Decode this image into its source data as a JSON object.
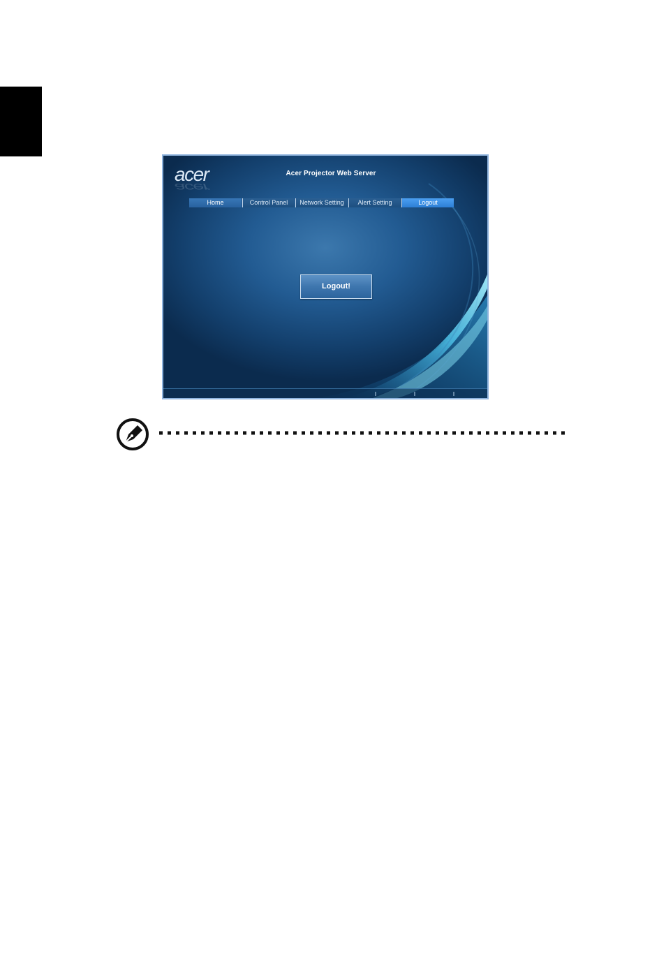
{
  "app": {
    "logo_text": "acer",
    "title": "Acer Projector Web Server"
  },
  "nav": {
    "items": [
      {
        "label": "Home"
      },
      {
        "label": "Control Panel"
      },
      {
        "label": "Network Setting"
      },
      {
        "label": "Alert Setting"
      },
      {
        "label": "Logout"
      }
    ],
    "active": "Logout"
  },
  "main": {
    "logout_button_label": "Logout!"
  },
  "colors": {
    "page_background": "#ffffff",
    "side_tab": "#000000",
    "frame_border": "#8fb4de",
    "app_background": "#225b92",
    "nav_active": "#2d7fd6",
    "accent_swoosh": "#5fd0ee"
  },
  "icons": {
    "note": "note-pen-icon",
    "logo": "acer-logo"
  }
}
